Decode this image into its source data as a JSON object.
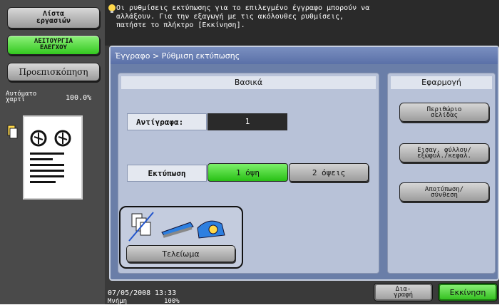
{
  "left": {
    "jobs_label": "Λίστα\nεργασιών",
    "check_label": "ΛΕΙΤΟΥΡΓΙΑ\nΕΛΕΓΧΟΥ",
    "preview_label": "Προεπισκόπηση",
    "paper_label": "Αυτόματο\nχαρτί",
    "zoom_label": "100.0%"
  },
  "message": {
    "text": "Οι ρυθμίσεις εκτύπωσης για το επιλεγμένο έγγραφο μπορούν να\nαλλάξουν. Για την εξαγωγή με τις ακόλουθες ρυθμίσεις,\nπατήστε το πλήκτρο [Εκκίνηση]."
  },
  "breadcrumb": "Έγγραφο > Ρύθμιση εκτύπωσης",
  "basic": {
    "header": "Βασικά",
    "copies_label": "Αντίγραφα:",
    "copies_value": "1",
    "print_label": "Εκτύπωση",
    "option_1": "1 όψη",
    "option_2": "2 όψεις",
    "finishing_label": "Τελείωμα"
  },
  "application": {
    "header": "Εφαρμογή",
    "margin": "Περιθώριο\nσελίδας",
    "sheets": "Εισαγ. φύλλου/\nεξώφυλ./κεφαλ.",
    "layout": "Αποτύπωση/\nσύνθεση"
  },
  "footer": {
    "date": "07/05/2008",
    "time": "13:33",
    "memory_label": "Μνήμη",
    "memory_value": "100%",
    "delete_label": "Δια-\nγραφή",
    "start_label": "Εκκίνηση"
  },
  "colors": {
    "accent_green": "#33c81f",
    "panel_blue": "#6a7ea8"
  }
}
